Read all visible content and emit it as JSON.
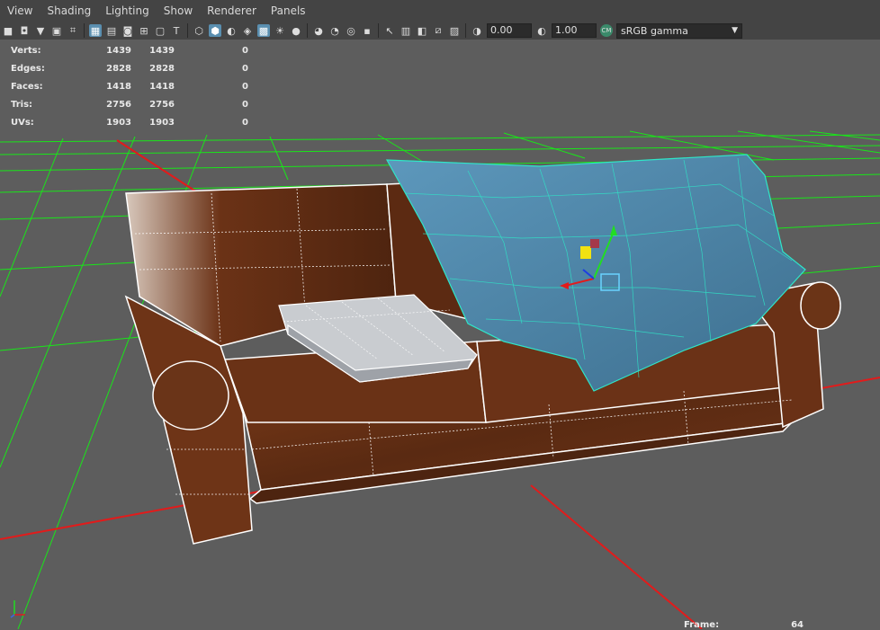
{
  "menu": [
    "View",
    "Shading",
    "Lighting",
    "Show",
    "Renderer",
    "Panels"
  ],
  "toolbar": {
    "exposure_value": "0.00",
    "gamma_value": "1.00",
    "colorspace_badge": "CM",
    "colorspace_label": "sRGB gamma"
  },
  "hud": {
    "rows": [
      {
        "label": "Verts:",
        "v1": "1439",
        "v2": "1439",
        "v3": "0"
      },
      {
        "label": "Edges:",
        "v1": "2828",
        "v2": "2828",
        "v3": "0"
      },
      {
        "label": "Faces:",
        "v1": "1418",
        "v2": "1418",
        "v3": "0"
      },
      {
        "label": "Tris:",
        "v1": "2756",
        "v2": "2756",
        "v3": "0"
      },
      {
        "label": "UVs:",
        "v1": "1903",
        "v2": "1903",
        "v3": "0"
      }
    ]
  },
  "frame": {
    "label": "Frame:",
    "value": "64"
  },
  "colors": {
    "viewport_bg": "#5d5d5d",
    "grid": "#19e619",
    "axis_x": "#e21b1b",
    "leather": "#6b3216",
    "blanket": "#4f86a9",
    "pillow": "#c9ccd0",
    "wireframe": "#ffffff",
    "blanket_wire": "#2fe6c8",
    "active_icon": "#5a8fb0"
  },
  "icons": [
    "camera-icon",
    "camera-attr-icon",
    "bookmark-icon",
    "image-plane-icon",
    "grid-icon",
    "film-gate-icon",
    "resolution-gate-icon",
    "gate-mask-icon",
    "field-chart-icon",
    "safe-action-icon",
    "wireframe-icon",
    "smooth-shade-icon",
    "default-material-icon",
    "textured-icon",
    "use-all-lights-icon",
    "shadows-icon",
    "ambient-occlusion-icon",
    "motion-blur-icon",
    "anti-alias-icon",
    "depth-of-field-icon",
    "isolate-select-icon",
    "xray-icon",
    "xray-joints-icon",
    "backface-icon",
    "exposure-icon",
    "gamma-icon",
    "color-management-icon"
  ]
}
